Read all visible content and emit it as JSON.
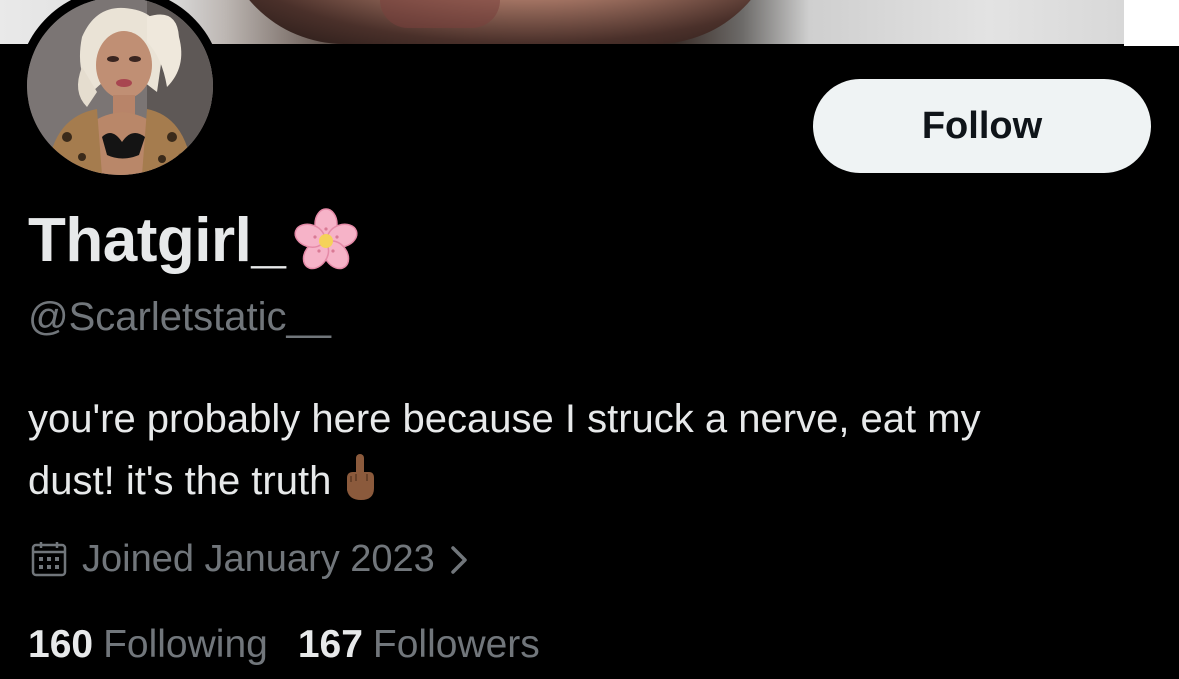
{
  "profile": {
    "display_name": "Thatgirl_",
    "name_emoji_icon": "cherry-blossom-icon",
    "handle": "@Scarletstatic__",
    "bio_line_1": "you're probably here because I struck a nerve, eat my",
    "bio_line_2": "dust! it's the truth",
    "bio_emoji_icon": "middle-finger-icon",
    "joined": "Joined January 2023",
    "following_count": "160",
    "following_label": "Following",
    "followers_count": "167",
    "followers_label": "Followers"
  },
  "actions": {
    "follow_label": "Follow"
  },
  "icons": {
    "calendar": "calendar-icon",
    "chevron": "chevron-right-icon"
  },
  "colors": {
    "background": "#000000",
    "primary_text": "#e7e9ea",
    "secondary_text": "#71767b",
    "follow_button_bg": "#eff3f4",
    "follow_button_text": "#0f1419"
  }
}
